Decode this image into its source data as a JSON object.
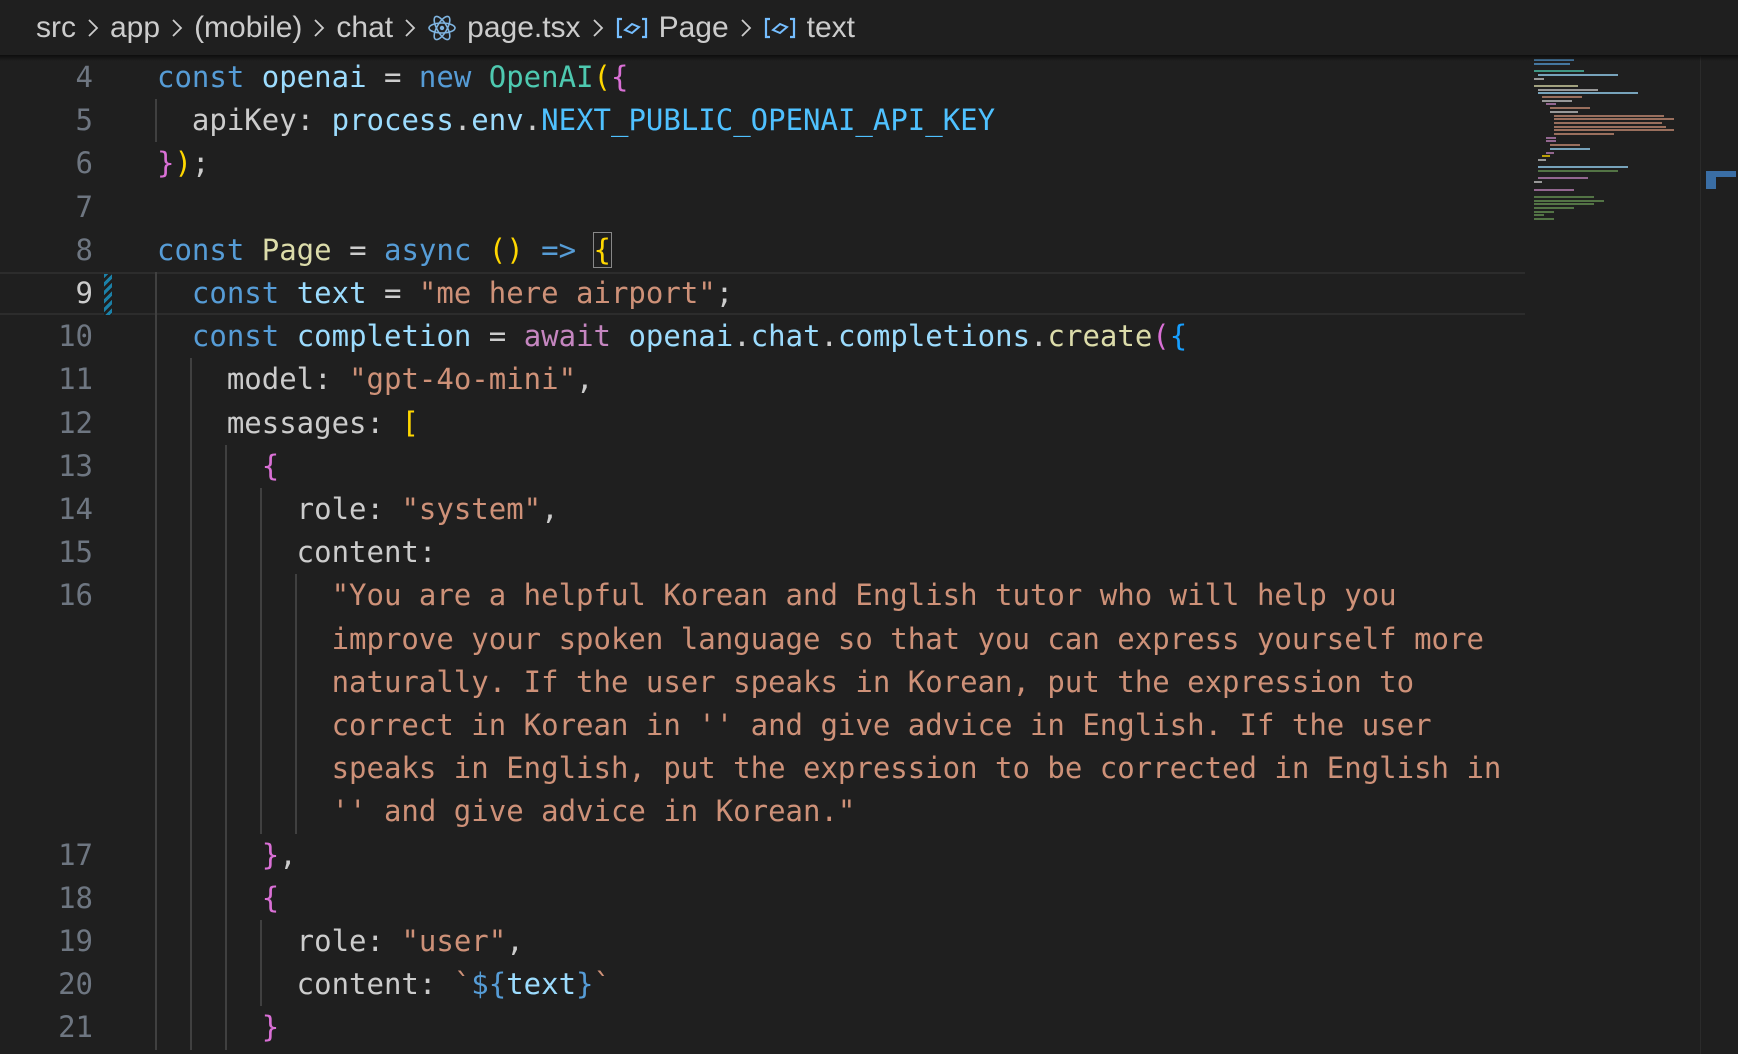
{
  "breadcrumb": {
    "items": [
      {
        "label": "src",
        "icon": null
      },
      {
        "label": "app",
        "icon": null
      },
      {
        "label": "(mobile)",
        "icon": null
      },
      {
        "label": "chat",
        "icon": null
      },
      {
        "label": "page.tsx",
        "icon": "react-icon"
      },
      {
        "label": "Page",
        "icon": "variable-icon"
      },
      {
        "label": "text",
        "icon": "variable-icon"
      }
    ],
    "separator_icon": "chevron-right-icon"
  },
  "editor": {
    "active_line": "9",
    "lines": [
      {
        "num": "4",
        "tokens": [
          [
            "const ",
            "k-blue"
          ],
          [
            "openai",
            "k-var"
          ],
          [
            " = ",
            ""
          ],
          [
            "new ",
            "k-blue"
          ],
          [
            "OpenAI",
            "k-class"
          ],
          [
            "(",
            "k-b1"
          ],
          [
            "{",
            "k-b2"
          ]
        ]
      },
      {
        "num": "5",
        "tokens": [
          [
            "  apiKey: ",
            ""
          ],
          [
            "process",
            "k-var"
          ],
          [
            ".",
            ""
          ],
          [
            "env",
            "k-var"
          ],
          [
            ".",
            ""
          ],
          [
            "NEXT_PUBLIC_OPENAI_API_KEY",
            "k-const"
          ]
        ]
      },
      {
        "num": "6",
        "tokens": [
          [
            "}",
            "k-b2"
          ],
          [
            ")",
            "k-b1"
          ],
          [
            ";",
            ""
          ]
        ]
      },
      {
        "num": "7",
        "tokens": []
      },
      {
        "num": "8",
        "tokens": [
          [
            "const ",
            "k-blue"
          ],
          [
            "Page",
            "k-fn"
          ],
          [
            " = ",
            ""
          ],
          [
            "async ",
            "k-blue"
          ],
          [
            "()",
            "k-b1"
          ],
          [
            " => ",
            "k-blue"
          ],
          [
            "{",
            "k-b1 bracket-match"
          ]
        ]
      },
      {
        "num": "9",
        "tokens": [
          [
            "  const ",
            "k-blue"
          ],
          [
            "text",
            "k-var"
          ],
          [
            " = ",
            ""
          ],
          [
            "\"me here airport\"",
            "k-str"
          ],
          [
            ";",
            ""
          ]
        ]
      },
      {
        "num": "10",
        "tokens": [
          [
            "  const ",
            "k-blue"
          ],
          [
            "completion",
            "k-var"
          ],
          [
            " = ",
            ""
          ],
          [
            "await ",
            "k-ctrl"
          ],
          [
            "openai",
            "k-var"
          ],
          [
            ".",
            ""
          ],
          [
            "chat",
            "k-var"
          ],
          [
            ".",
            ""
          ],
          [
            "completions",
            "k-var"
          ],
          [
            ".",
            ""
          ],
          [
            "create",
            "k-fn"
          ],
          [
            "(",
            "k-b2"
          ],
          [
            "{",
            "k-b3"
          ]
        ]
      },
      {
        "num": "11",
        "tokens": [
          [
            "    model: ",
            ""
          ],
          [
            "\"gpt-4o-mini\"",
            "k-str"
          ],
          [
            ",",
            ""
          ]
        ]
      },
      {
        "num": "12",
        "tokens": [
          [
            "    messages: ",
            ""
          ],
          [
            "[",
            "k-b1"
          ]
        ]
      },
      {
        "num": "13",
        "tokens": [
          [
            "      ",
            ""
          ],
          [
            "{",
            "k-b2"
          ]
        ]
      },
      {
        "num": "14",
        "tokens": [
          [
            "        role: ",
            ""
          ],
          [
            "\"system\"",
            "k-str"
          ],
          [
            ",",
            ""
          ]
        ]
      },
      {
        "num": "15",
        "tokens": [
          [
            "        content:",
            ""
          ]
        ]
      },
      {
        "num": "16",
        "tokens": [
          [
            "          \"You are a helpful Korean and English tutor who will help you",
            "k-str"
          ]
        ]
      },
      {
        "num": "",
        "tokens": [
          [
            "          improve your spoken language so that you can express yourself more",
            "k-str"
          ]
        ]
      },
      {
        "num": "",
        "tokens": [
          [
            "          naturally. If the user speaks in Korean, put the expression to",
            "k-str"
          ]
        ]
      },
      {
        "num": "",
        "tokens": [
          [
            "          correct in Korean in '' and give advice in English. If the user",
            "k-str"
          ]
        ]
      },
      {
        "num": "",
        "tokens": [
          [
            "          speaks in English, put the expression to be corrected in English in",
            "k-str"
          ]
        ]
      },
      {
        "num": "",
        "tokens": [
          [
            "          '' and give advice in Korean.\"",
            "k-str"
          ]
        ]
      },
      {
        "num": "17",
        "tokens": [
          [
            "      ",
            ""
          ],
          [
            "}",
            "k-b2"
          ],
          [
            ",",
            ""
          ]
        ]
      },
      {
        "num": "18",
        "tokens": [
          [
            "      ",
            ""
          ],
          [
            "{",
            "k-b2"
          ]
        ]
      },
      {
        "num": "19",
        "tokens": [
          [
            "        role: ",
            ""
          ],
          [
            "\"user\"",
            "k-str"
          ],
          [
            ",",
            ""
          ]
        ]
      },
      {
        "num": "20",
        "tokens": [
          [
            "        content: ",
            ""
          ],
          [
            "`",
            "k-str"
          ],
          [
            "${",
            "k-blue"
          ],
          [
            "text",
            "k-var"
          ],
          [
            "}",
            "k-blue"
          ],
          [
            "`",
            "k-str"
          ]
        ]
      },
      {
        "num": "21",
        "tokens": [
          [
            "      ",
            ""
          ],
          [
            "}",
            "k-b2"
          ]
        ]
      }
    ]
  },
  "colors": {
    "background": "#1f1f1f",
    "line_number": "#6e7681",
    "line_number_active": "#cccccc",
    "keyword": "#569cd6",
    "variable": "#9cdcfe",
    "string": "#ce9178",
    "function": "#dcdcaa",
    "class": "#4ec9b0"
  }
}
